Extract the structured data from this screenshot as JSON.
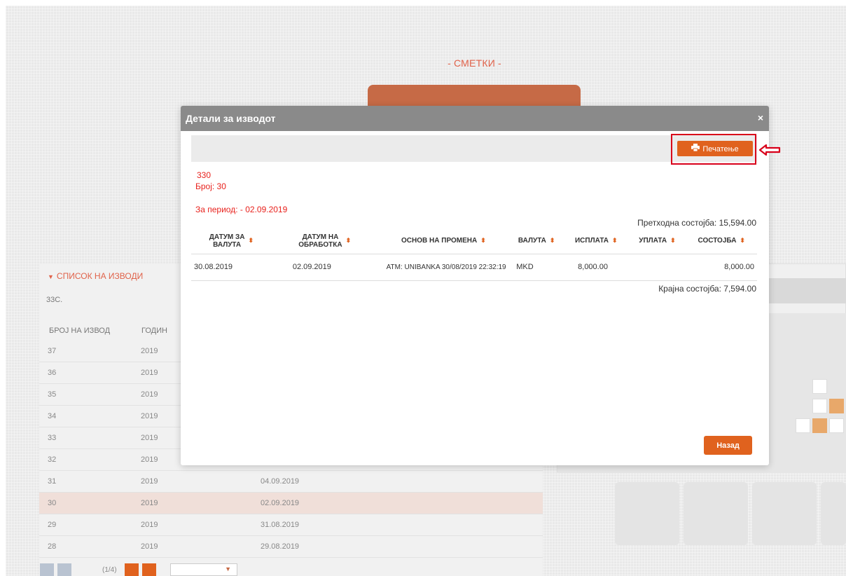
{
  "page": {
    "title": "- СМЕТКИ -"
  },
  "left_panel": {
    "header": "СПИСОК НА ИЗВОДИ",
    "account": "33C.",
    "col_number": "БРОЈ НА ИЗВОД",
    "col_year": "ГОДИН",
    "rows": [
      {
        "num": "37",
        "year": "2019",
        "date": ""
      },
      {
        "num": "36",
        "year": "2019",
        "date": ""
      },
      {
        "num": "35",
        "year": "2019",
        "date": ""
      },
      {
        "num": "34",
        "year": "2019",
        "date": ""
      },
      {
        "num": "33",
        "year": "2019",
        "date": ""
      },
      {
        "num": "32",
        "year": "2019",
        "date": ""
      },
      {
        "num": "31",
        "year": "2019",
        "date": "04.09.2019"
      },
      {
        "num": "30",
        "year": "2019",
        "date": "02.09.2019"
      },
      {
        "num": "29",
        "year": "2019",
        "date": "31.08.2019"
      },
      {
        "num": "28",
        "year": "2019",
        "date": "29.08.2019"
      }
    ],
    "pager_text": "(1/4)"
  },
  "modal": {
    "title": "Детали за изводот",
    "close": "×",
    "print_label": "Печатење",
    "account_no": "330",
    "broj": "Број:  30",
    "period": "За период:  - 02.09.2019",
    "prev_balance": "Претходна состојба:  15,594.00",
    "end_balance": "Крајна состојба:  7,594.00",
    "back_label": "Назад",
    "columns": {
      "value_date_1": "ДАТУМ ЗА",
      "value_date_2": "ВАЛУТА",
      "proc_date_1": "ДАТУМ НА",
      "proc_date_2": "ОБРАБОТКА",
      "basis": "ОСНОВ НА ПРОМЕНА",
      "currency": "ВАЛУТА",
      "debit": "ИСПЛАТА",
      "credit": "УПЛАТА",
      "balance": "СОСТОЈБА"
    },
    "rows": [
      {
        "value_date": "30.08.2019",
        "proc_date": "02.09.2019",
        "basis": "ATM: UNIBANKA 30/08/2019 22:32:19",
        "currency": "MKD",
        "debit": "8,000.00",
        "credit": "",
        "balance": "8,000.00"
      }
    ]
  },
  "colors": {
    "accent": "#e0621e",
    "red_text": "#e8211c",
    "highlight": "#d9001b"
  }
}
